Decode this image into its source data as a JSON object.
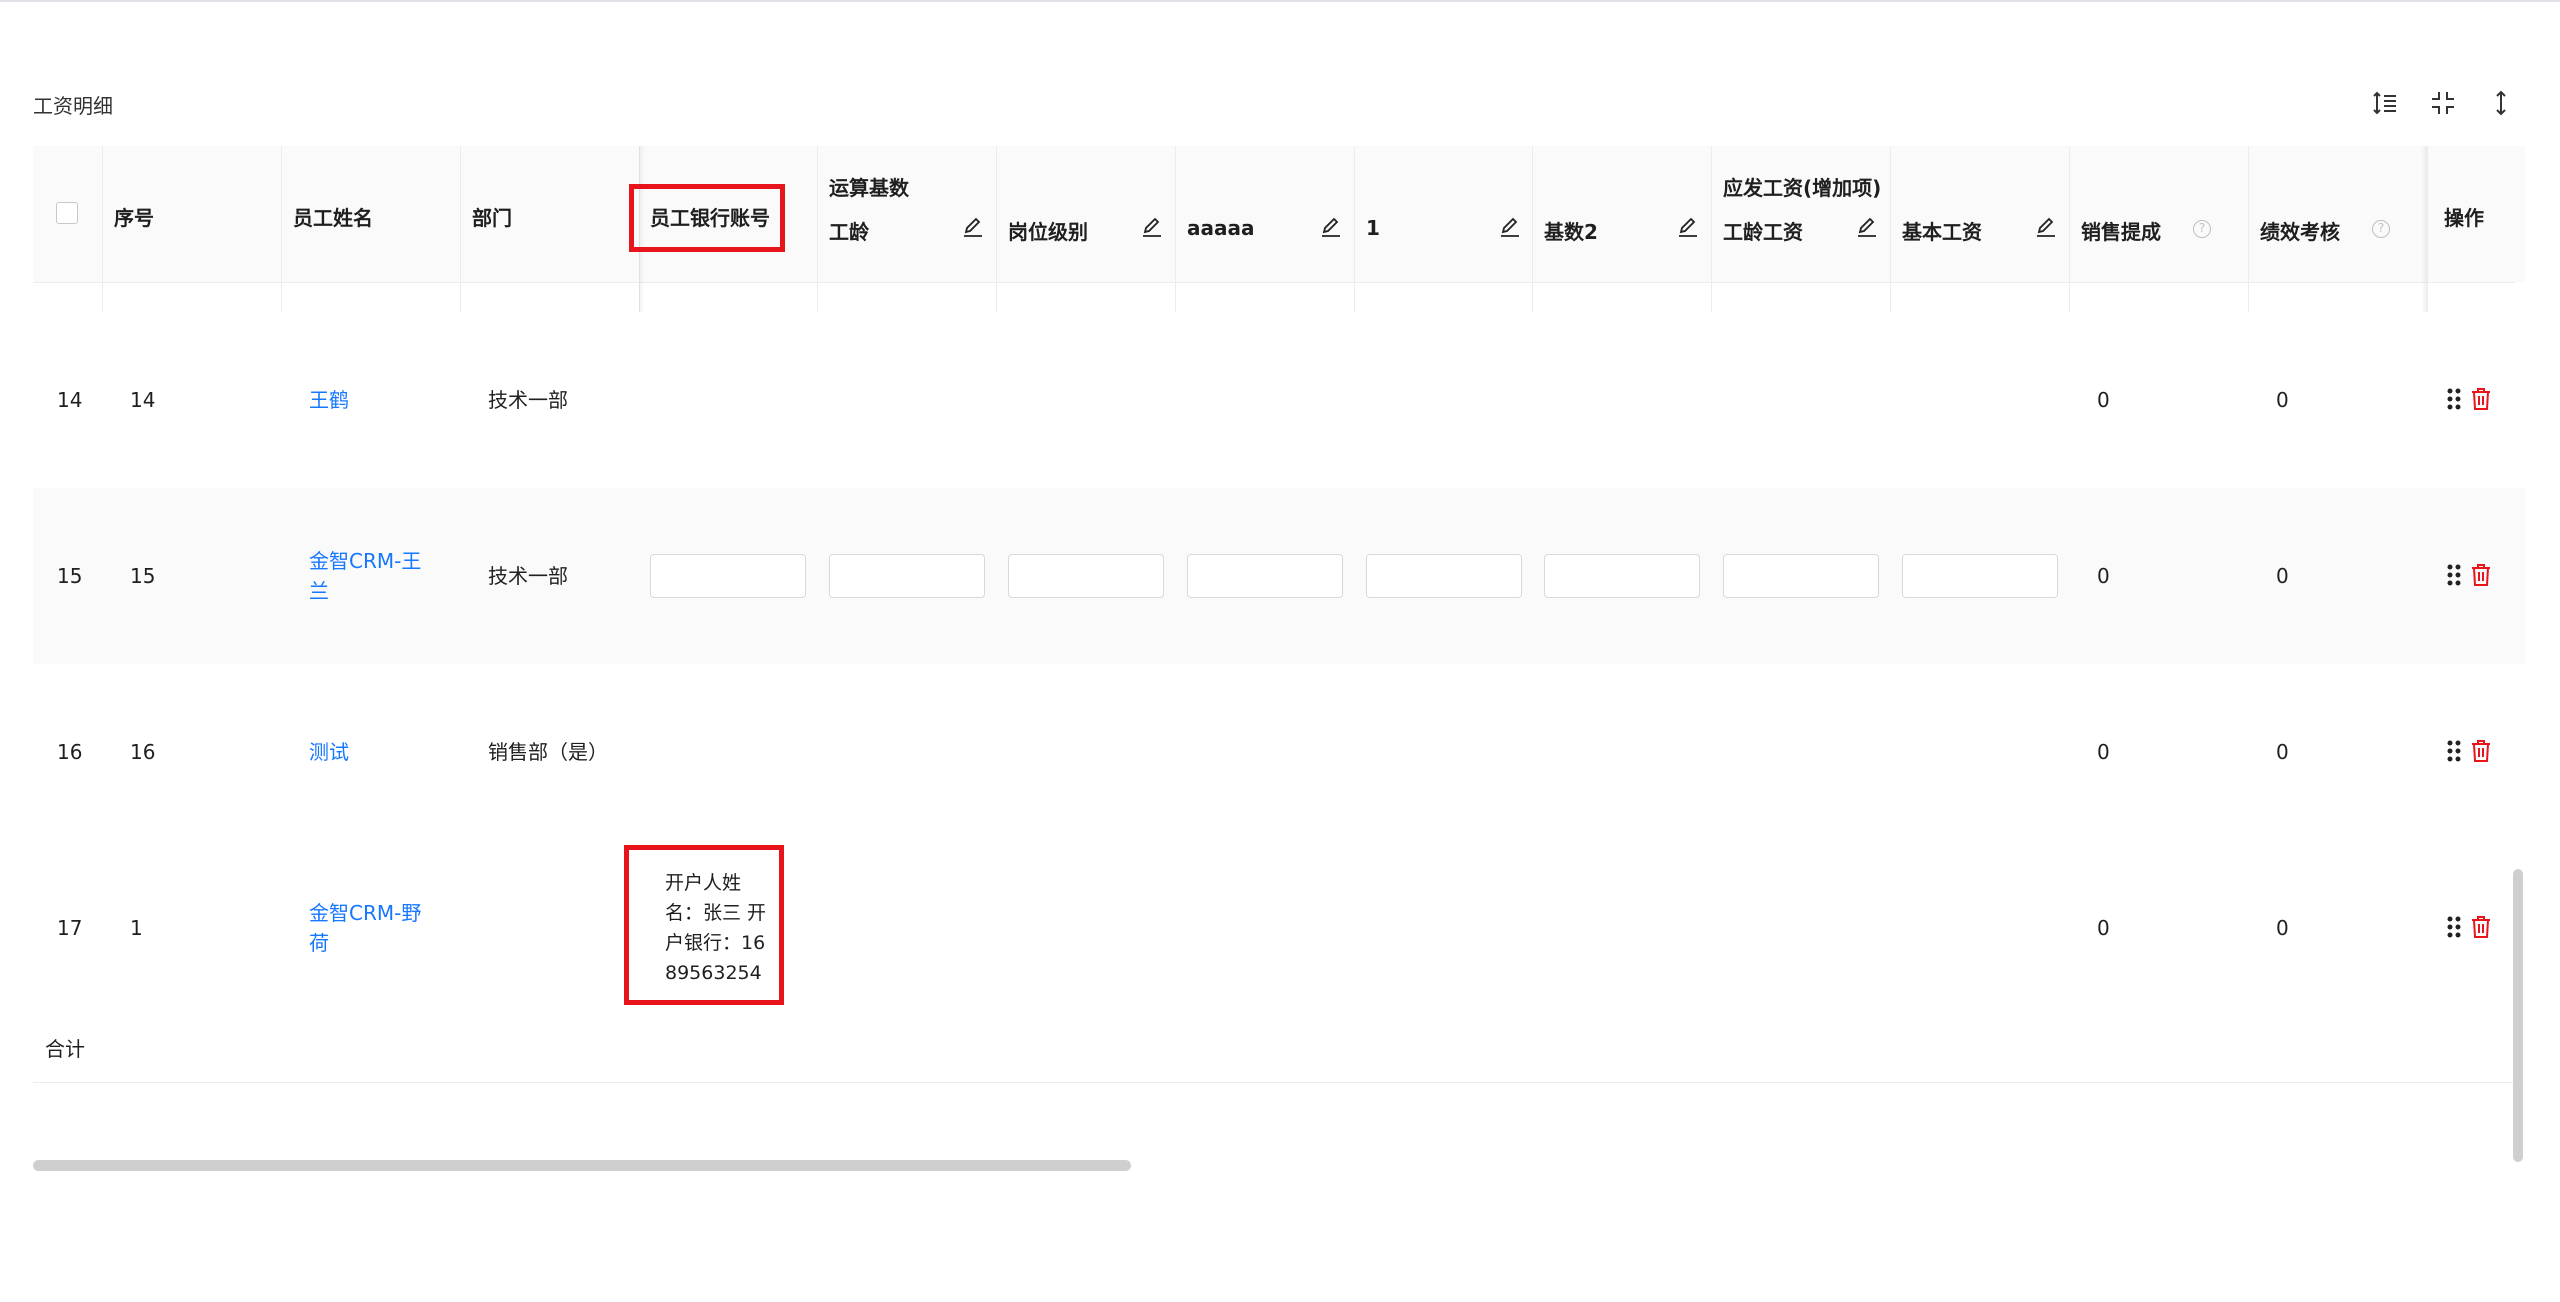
{
  "section_title": "工资明细",
  "toolbar": {
    "icons": [
      "line-height-icon",
      "compress-icon",
      "column-height-icon"
    ]
  },
  "table": {
    "columns": {
      "seq": "序号",
      "name": "员工姓名",
      "dept": "部门",
      "bank": "员工银行账号",
      "group1": "运算基数",
      "gongling": "工龄",
      "gangwei": "岗位级别",
      "aaaaa": "aaaaa",
      "one": "1",
      "jishu2": "基数2",
      "group2": "应发工资(增加项)",
      "glgz": "工龄工资",
      "jbgz": "基本工资",
      "xstc": "销售提成",
      "jxkh": "绩效考核",
      "ops": "操作"
    },
    "rows": [
      {
        "index": "14",
        "seq": "14",
        "name": "王鹤",
        "dept": "技术一部",
        "bank": "",
        "xstc": "0",
        "jxkh": "0"
      },
      {
        "index": "15",
        "seq": "15",
        "name": "金智CRM-王兰",
        "dept": "技术一部",
        "bank": "",
        "xstc": "0",
        "jxkh": "0"
      },
      {
        "index": "16",
        "seq": "16",
        "name": "测试",
        "dept": "销售部（是）",
        "bank": "",
        "xstc": "0",
        "jxkh": "0"
      },
      {
        "index": "17",
        "seq": "1",
        "name": "金智CRM-野荷",
        "dept": "",
        "bank": "开户人姓名：张三 开户银行：1689563254",
        "xstc": "0",
        "jxkh": "0"
      }
    ],
    "total_label": "合计"
  },
  "highlight_color": "#e8141b",
  "link_color": "#1677ff"
}
